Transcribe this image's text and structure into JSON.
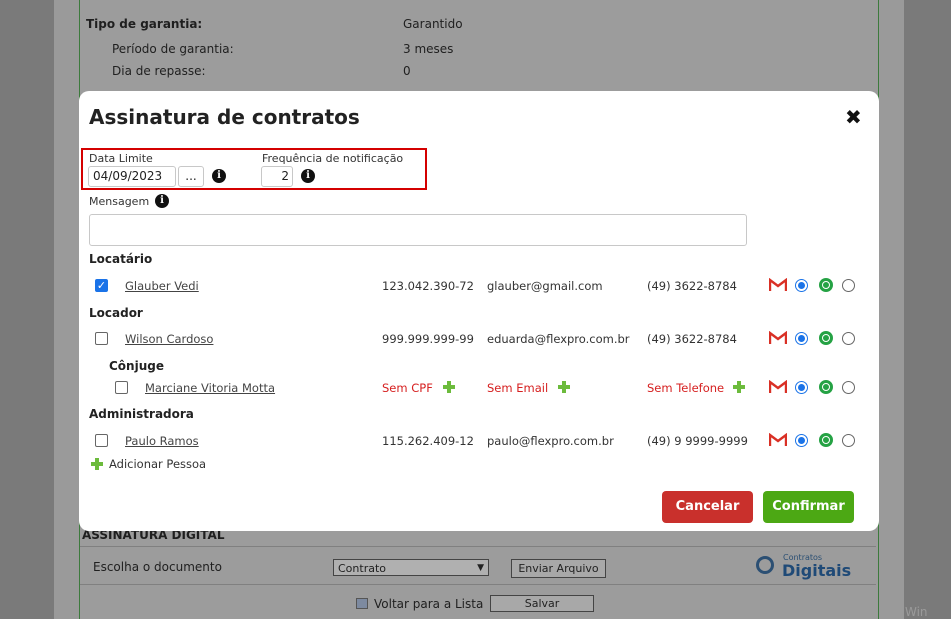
{
  "background": {
    "rows": [
      {
        "label": "Tipo de garantia:",
        "value": "Garantido",
        "bold": true
      },
      {
        "label": "Período de garantia:",
        "value": "3 meses"
      },
      {
        "label": "Dia de repasse:",
        "value": "0"
      }
    ],
    "section_title": "ASSINATURA DIGITAL",
    "choose_document_label": "Escolha o documento",
    "document_select_value": "Contrato",
    "send_file_button": "Enviar Arquivo",
    "brand_small": "Contratos",
    "brand_big": "Digitais",
    "back_link": "Voltar para a Lista",
    "save_button": "Salvar",
    "watermark": "Win"
  },
  "modal": {
    "title": "Assinatura de contratos",
    "close_symbol": "✖",
    "deadline_label": "Data Limite",
    "deadline_value": "04/09/2023",
    "deadline_picker": "...",
    "frequency_label": "Frequência de notificação",
    "frequency_value": "2",
    "message_label": "Mensagem",
    "message_value": "",
    "info_glyph": "i",
    "sections": {
      "tenant": "Locatário",
      "landlord": "Locador",
      "spouse": "Cônjuge",
      "admin": "Administradora"
    },
    "people": {
      "tenant": {
        "name": "Glauber Vedi",
        "cpf": "123.042.390-72",
        "email": "glauber@gmail.com",
        "phone": "(49) 3622-8784",
        "checked": true
      },
      "landlord": {
        "name": "Wilson Cardoso",
        "cpf": "999.999.999-99",
        "email": "eduarda@flexpro.com.br",
        "phone": "(49) 3622-8784",
        "checked": false
      },
      "spouse": {
        "name": "Marciane Vitoria Motta",
        "cpf": "Sem CPF",
        "email": "Sem Email",
        "phone": "Sem Telefone",
        "checked": false
      },
      "admin": {
        "name": "Paulo Ramos",
        "cpf": "115.262.409-12",
        "email": "paulo@flexpro.com.br",
        "phone": "(49) 9 9999-9999",
        "checked": false
      }
    },
    "add_person": "Adicionar Pessoa",
    "cancel_button": "Cancelar",
    "confirm_button": "Confirmar"
  },
  "colors": {
    "cancel": "#c9302c",
    "confirm": "#4ca814",
    "highlight_box": "#d40000",
    "missing_text": "#d62020"
  }
}
